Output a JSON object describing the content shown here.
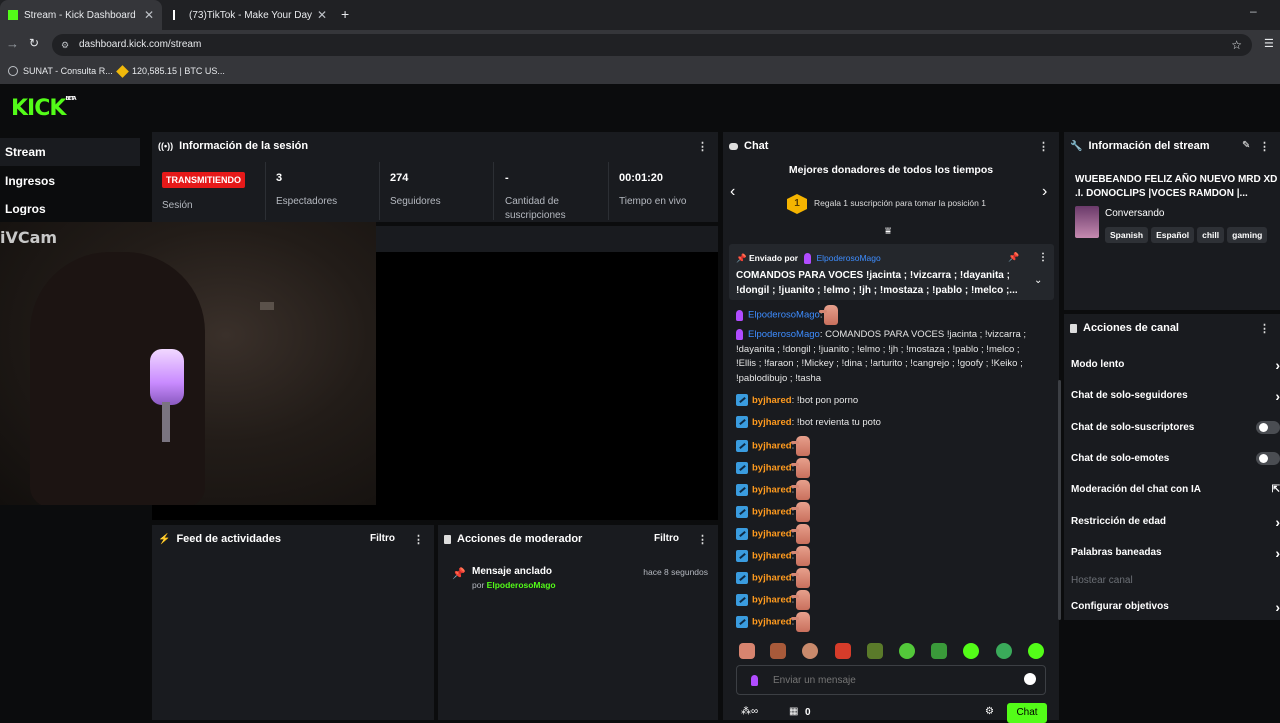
{
  "browser": {
    "tabs": [
      {
        "label": "Stream - Kick Dashboard",
        "active": true
      },
      {
        "label": "(73)TikTok - Make Your Day",
        "active": false
      }
    ],
    "url": "dashboard.kick.com/stream",
    "bookmarks": [
      "SUNAT - Consulta R...",
      "120,585.15 | BTC US..."
    ]
  },
  "logo": {
    "text": "KICK",
    "beta": "BETA"
  },
  "sidebar": {
    "items": [
      {
        "label": "Stream",
        "active": true
      },
      {
        "label": "Ingresos",
        "active": false
      },
      {
        "label": "Logros",
        "active": false
      }
    ]
  },
  "video": {
    "watermark": "iVCam"
  },
  "session": {
    "title": "Información de la sesión",
    "status_badge": "TRANSMITIENDO",
    "status_label": "Sesión",
    "stats": [
      {
        "value": "3",
        "label": "Espectadores"
      },
      {
        "value": "274",
        "label": "Seguidores"
      },
      {
        "value": "-",
        "label": "Cantidad de suscripciones"
      },
      {
        "value": "00:01:20",
        "label": "Tiempo en vivo"
      }
    ]
  },
  "feed": {
    "title": "Feed de actividades",
    "filter": "Filtro"
  },
  "moderator": {
    "title": "Acciones de moderador",
    "filter": "Filtro",
    "item_title": "Mensaje anclado",
    "item_by": "por",
    "item_user": "ElpoderosoMago",
    "item_time": "hace 8 segundos"
  },
  "chat": {
    "title": "Chat",
    "donors_title": "Mejores donadores de todos los tiempos",
    "donor_rank": "1",
    "donor_text": "Regala 1 suscripción para tomar la posición 1",
    "pinned": {
      "sent_by": "Enviado por",
      "user": "ElpoderosoMago",
      "text": "COMANDOS PARA VOCES !jacinta ; !vizcarra ; !dayanita ; !dongil ; !juanito ; !elmo ; !jh ; !mostaza ; !pablo ; !melco ;..."
    },
    "messages": [
      {
        "user": "ElpoderosoMago",
        "text": "",
        "type": "mago"
      },
      {
        "user": "ElpoderosoMago",
        "text": "COMANDOS PARA VOCES !jacinta ; !vizcarra ; !dayanita ; !dongil ; !juanito ; !elmo ; !jh ; !mostaza ; !pablo ; !melco ; !Ellis ; !faraon ; !Mickey ; !dina ; !arturito ; !cangrejo ; !goofy ; !Keiko ; !pablodibujo ; !tasha",
        "type": "mago"
      },
      {
        "user": "byjhared",
        "text": "!bot pon porno",
        "type": "bj"
      },
      {
        "user": "byjhared",
        "text": "!bot revienta tu poto",
        "type": "bj"
      },
      {
        "user": "byjhared",
        "text": "",
        "type": "bj"
      },
      {
        "user": "byjhared",
        "text": "",
        "type": "bj"
      },
      {
        "user": "byjhared",
        "text": "",
        "type": "bj"
      },
      {
        "user": "byjhared",
        "text": "",
        "type": "bj"
      },
      {
        "user": "byjhared",
        "text": "",
        "type": "bj"
      },
      {
        "user": "byjhared",
        "text": "",
        "type": "bj"
      },
      {
        "user": "byjhared",
        "text": "",
        "type": "bj"
      },
      {
        "user": "byjhared",
        "text": "",
        "type": "bj"
      },
      {
        "user": "byjhared",
        "text": "",
        "type": "bj"
      }
    ],
    "input_placeholder": "Enviar un mensaje",
    "viewer_count": "0",
    "send_label": "Chat"
  },
  "stream_info": {
    "title": "Información del stream",
    "stream_title": "WUEBEANDO FELIZ AÑO NUEVO MRD XD .I. DONOCLIPS |VOCES RAMDON |...",
    "category": "Conversando",
    "tags": [
      "Spanish",
      "Español",
      "chill",
      "gaming"
    ]
  },
  "channel_actions": {
    "title": "Acciones de canal",
    "items": [
      {
        "label": "Modo lento",
        "control": "chevron"
      },
      {
        "label": "Chat de solo-seguidores",
        "control": "chevron"
      },
      {
        "label": "Chat de solo-suscriptores",
        "control": "toggle"
      },
      {
        "label": "Chat de solo-emotes",
        "control": "toggle"
      },
      {
        "label": "Moderación del chat con IA",
        "control": "external"
      },
      {
        "label": "Restricción de edad",
        "control": "chevron"
      },
      {
        "label": "Palabras baneadas",
        "control": "chevron"
      },
      {
        "label": "Hostear canal",
        "control": "disabled"
      },
      {
        "label": "Configurar objetivos",
        "control": "chevron"
      }
    ]
  },
  "colors": {
    "brand": "#53fc18",
    "live": "#e61919",
    "mago": "#3e8dff",
    "byjhared": "#ff9b1f"
  }
}
